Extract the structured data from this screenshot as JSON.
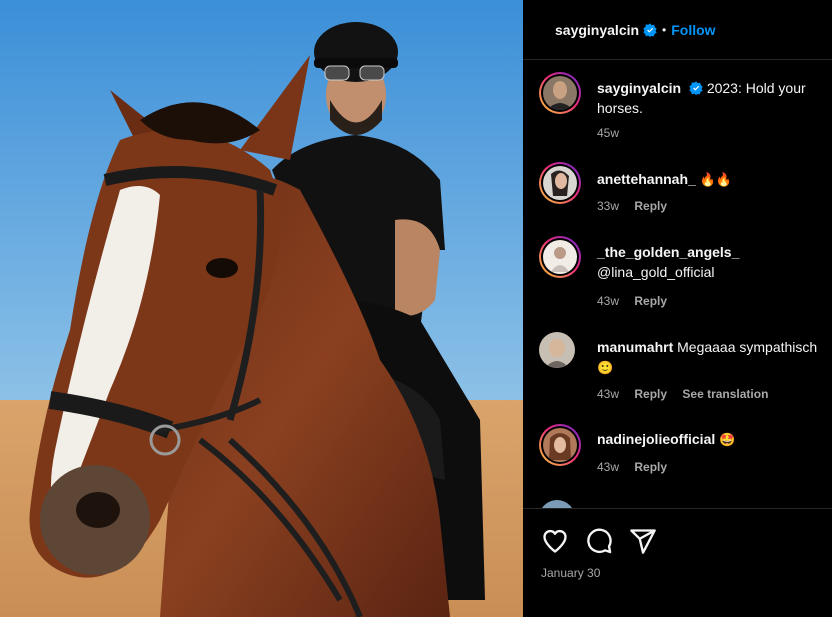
{
  "header": {
    "username": "sayginyalcin",
    "separator": "•",
    "follow_label": "Follow"
  },
  "caption": {
    "username": "sayginyalcin",
    "text": "2023: Hold your",
    "text_line2": "horses.",
    "time": "45w"
  },
  "comments": [
    {
      "username": "anettehannah_",
      "text": "🔥🔥",
      "time": "33w",
      "reply": "Reply"
    },
    {
      "username": "_the_golden_angels_",
      "text": "@lina_gold_official",
      "time": "43w",
      "reply": "Reply"
    },
    {
      "username": "manumahrt",
      "text": "Megaaaa sympathisch",
      "text_line2": "🙂",
      "time": "43w",
      "reply": "Reply",
      "translate": "See translation"
    },
    {
      "username": "nadinejolieofficial",
      "text": "🤩",
      "time": "43w",
      "reply": "Reply"
    },
    {
      "username": "",
      "text": "",
      "time": "",
      "reply": ""
    }
  ],
  "actions": {
    "like_icon": "heart-icon",
    "comment_icon": "comment-icon",
    "share_icon": "share-icon"
  },
  "post_date": "January 30",
  "colors": {
    "accent": "#0095f6",
    "background": "#000000",
    "muted": "#a8a8a8"
  }
}
